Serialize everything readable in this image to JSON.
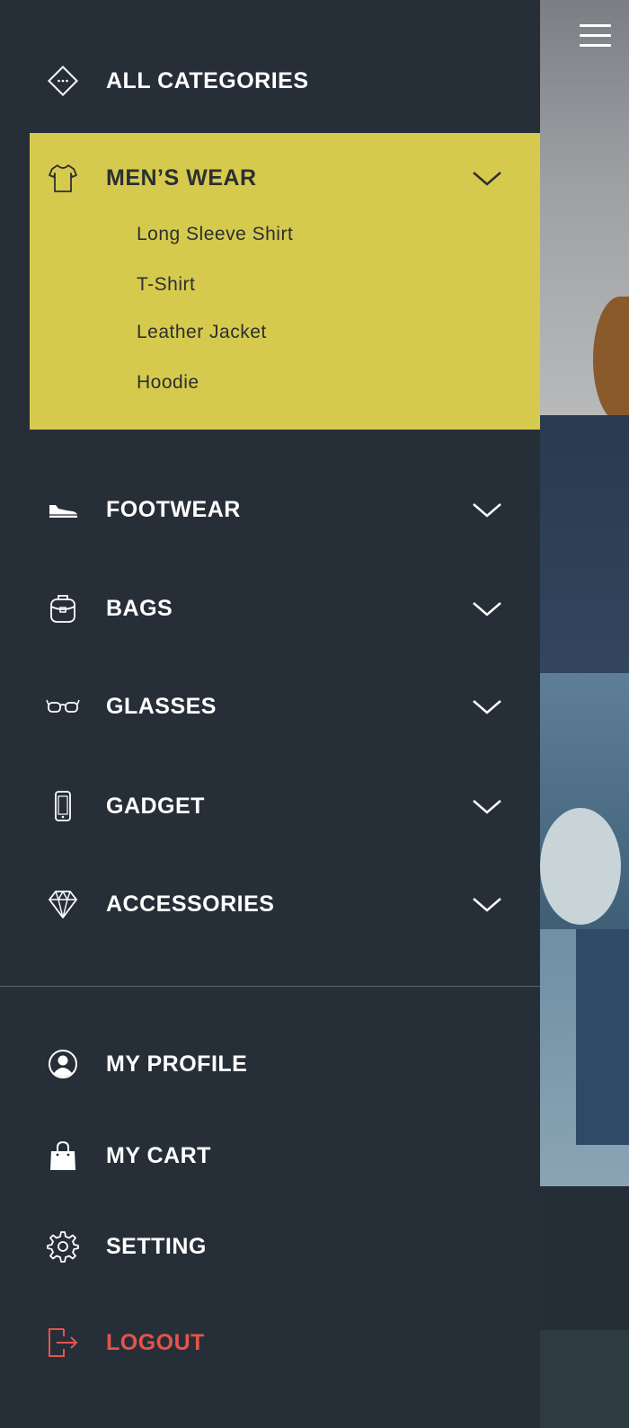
{
  "menu": {
    "all_categories": "ALL CATEGORIES",
    "mens_wear": {
      "label": "MEN’S WEAR",
      "items": [
        "Long Sleeve Shirt",
        "T-Shirt",
        "Leather Jacket",
        "Hoodie"
      ]
    },
    "categories": [
      {
        "label": "FOOTWEAR",
        "icon": "shoe-icon"
      },
      {
        "label": "BAGS",
        "icon": "backpack-icon"
      },
      {
        "label": "GLASSES",
        "icon": "glasses-icon"
      },
      {
        "label": "GADGET",
        "icon": "phone-icon"
      },
      {
        "label": "ACCESSORIES",
        "icon": "diamond-icon"
      }
    ],
    "account": {
      "profile": "MY PROFILE",
      "cart": "MY CART",
      "setting": "SETTING",
      "logout": "LOGOUT"
    }
  },
  "colors": {
    "drawer_bg": "#262f38",
    "highlight": "#d6ca4e",
    "logout": "#e6534c",
    "text": "#ffffff"
  }
}
